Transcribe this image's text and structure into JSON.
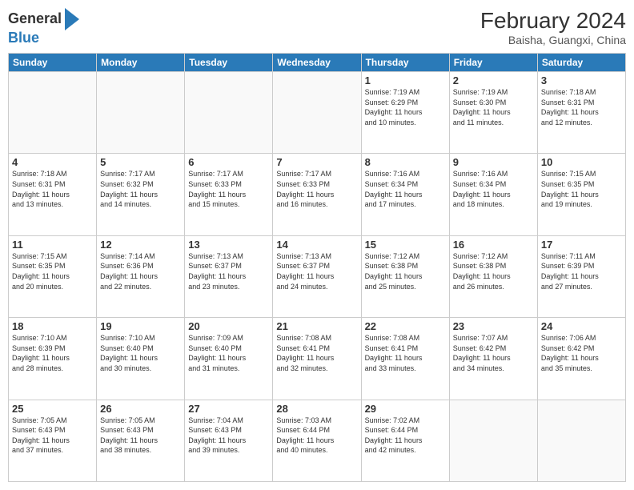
{
  "header": {
    "logo_general": "General",
    "logo_blue": "Blue",
    "month_year": "February 2024",
    "location": "Baisha, Guangxi, China"
  },
  "days_of_week": [
    "Sunday",
    "Monday",
    "Tuesday",
    "Wednesday",
    "Thursday",
    "Friday",
    "Saturday"
  ],
  "weeks": [
    [
      {
        "day": "",
        "info": ""
      },
      {
        "day": "",
        "info": ""
      },
      {
        "day": "",
        "info": ""
      },
      {
        "day": "",
        "info": ""
      },
      {
        "day": "1",
        "info": "Sunrise: 7:19 AM\nSunset: 6:29 PM\nDaylight: 11 hours\nand 10 minutes."
      },
      {
        "day": "2",
        "info": "Sunrise: 7:19 AM\nSunset: 6:30 PM\nDaylight: 11 hours\nand 11 minutes."
      },
      {
        "day": "3",
        "info": "Sunrise: 7:18 AM\nSunset: 6:31 PM\nDaylight: 11 hours\nand 12 minutes."
      }
    ],
    [
      {
        "day": "4",
        "info": "Sunrise: 7:18 AM\nSunset: 6:31 PM\nDaylight: 11 hours\nand 13 minutes."
      },
      {
        "day": "5",
        "info": "Sunrise: 7:17 AM\nSunset: 6:32 PM\nDaylight: 11 hours\nand 14 minutes."
      },
      {
        "day": "6",
        "info": "Sunrise: 7:17 AM\nSunset: 6:33 PM\nDaylight: 11 hours\nand 15 minutes."
      },
      {
        "day": "7",
        "info": "Sunrise: 7:17 AM\nSunset: 6:33 PM\nDaylight: 11 hours\nand 16 minutes."
      },
      {
        "day": "8",
        "info": "Sunrise: 7:16 AM\nSunset: 6:34 PM\nDaylight: 11 hours\nand 17 minutes."
      },
      {
        "day": "9",
        "info": "Sunrise: 7:16 AM\nSunset: 6:34 PM\nDaylight: 11 hours\nand 18 minutes."
      },
      {
        "day": "10",
        "info": "Sunrise: 7:15 AM\nSunset: 6:35 PM\nDaylight: 11 hours\nand 19 minutes."
      }
    ],
    [
      {
        "day": "11",
        "info": "Sunrise: 7:15 AM\nSunset: 6:35 PM\nDaylight: 11 hours\nand 20 minutes."
      },
      {
        "day": "12",
        "info": "Sunrise: 7:14 AM\nSunset: 6:36 PM\nDaylight: 11 hours\nand 22 minutes."
      },
      {
        "day": "13",
        "info": "Sunrise: 7:13 AM\nSunset: 6:37 PM\nDaylight: 11 hours\nand 23 minutes."
      },
      {
        "day": "14",
        "info": "Sunrise: 7:13 AM\nSunset: 6:37 PM\nDaylight: 11 hours\nand 24 minutes."
      },
      {
        "day": "15",
        "info": "Sunrise: 7:12 AM\nSunset: 6:38 PM\nDaylight: 11 hours\nand 25 minutes."
      },
      {
        "day": "16",
        "info": "Sunrise: 7:12 AM\nSunset: 6:38 PM\nDaylight: 11 hours\nand 26 minutes."
      },
      {
        "day": "17",
        "info": "Sunrise: 7:11 AM\nSunset: 6:39 PM\nDaylight: 11 hours\nand 27 minutes."
      }
    ],
    [
      {
        "day": "18",
        "info": "Sunrise: 7:10 AM\nSunset: 6:39 PM\nDaylight: 11 hours\nand 28 minutes."
      },
      {
        "day": "19",
        "info": "Sunrise: 7:10 AM\nSunset: 6:40 PM\nDaylight: 11 hours\nand 30 minutes."
      },
      {
        "day": "20",
        "info": "Sunrise: 7:09 AM\nSunset: 6:40 PM\nDaylight: 11 hours\nand 31 minutes."
      },
      {
        "day": "21",
        "info": "Sunrise: 7:08 AM\nSunset: 6:41 PM\nDaylight: 11 hours\nand 32 minutes."
      },
      {
        "day": "22",
        "info": "Sunrise: 7:08 AM\nSunset: 6:41 PM\nDaylight: 11 hours\nand 33 minutes."
      },
      {
        "day": "23",
        "info": "Sunrise: 7:07 AM\nSunset: 6:42 PM\nDaylight: 11 hours\nand 34 minutes."
      },
      {
        "day": "24",
        "info": "Sunrise: 7:06 AM\nSunset: 6:42 PM\nDaylight: 11 hours\nand 35 minutes."
      }
    ],
    [
      {
        "day": "25",
        "info": "Sunrise: 7:05 AM\nSunset: 6:43 PM\nDaylight: 11 hours\nand 37 minutes."
      },
      {
        "day": "26",
        "info": "Sunrise: 7:05 AM\nSunset: 6:43 PM\nDaylight: 11 hours\nand 38 minutes."
      },
      {
        "day": "27",
        "info": "Sunrise: 7:04 AM\nSunset: 6:43 PM\nDaylight: 11 hours\nand 39 minutes."
      },
      {
        "day": "28",
        "info": "Sunrise: 7:03 AM\nSunset: 6:44 PM\nDaylight: 11 hours\nand 40 minutes."
      },
      {
        "day": "29",
        "info": "Sunrise: 7:02 AM\nSunset: 6:44 PM\nDaylight: 11 hours\nand 42 minutes."
      },
      {
        "day": "",
        "info": ""
      },
      {
        "day": "",
        "info": ""
      }
    ]
  ]
}
